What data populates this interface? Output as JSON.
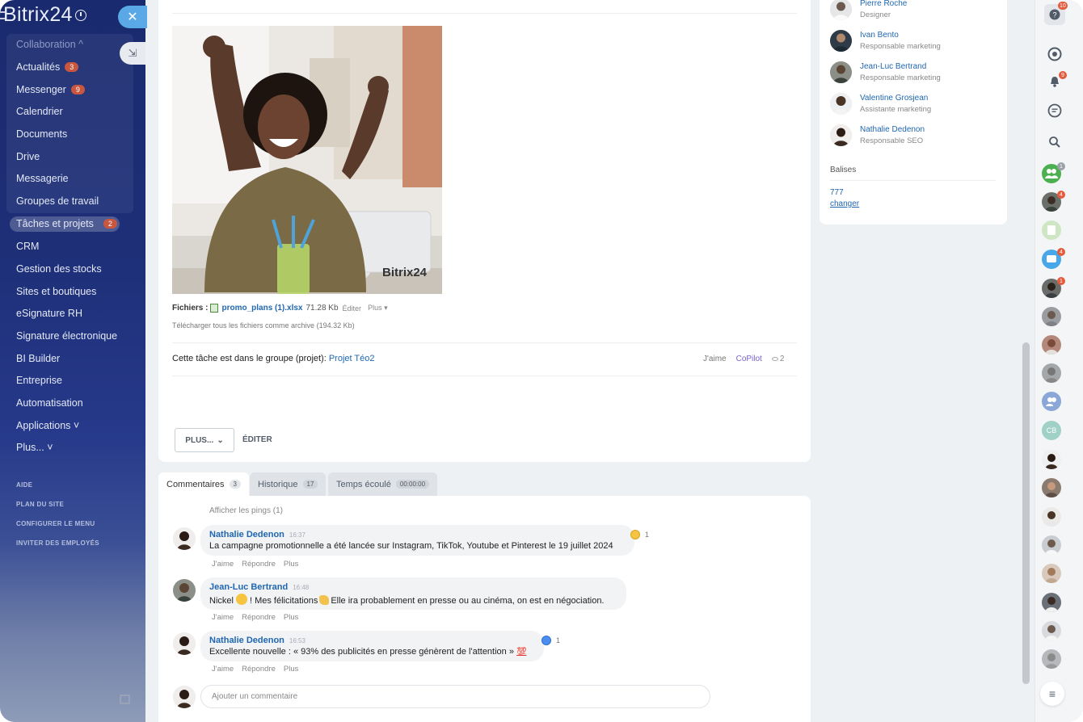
{
  "sidebar": {
    "logo": "Bitrix24",
    "collaboration_header": "Collaboration ^",
    "items": [
      {
        "label": "Actualités",
        "badge": "3"
      },
      {
        "label": "Messenger",
        "badge": "9"
      },
      {
        "label": "Calendrier"
      },
      {
        "label": "Documents"
      },
      {
        "label": "Drive"
      },
      {
        "label": "Messagerie"
      },
      {
        "label": "Groupes de travail"
      },
      {
        "label": "Tâches et projets",
        "badge": "2"
      },
      {
        "label": "CRM"
      },
      {
        "label": "Gestion des stocks"
      },
      {
        "label": "Sites et boutiques"
      },
      {
        "label": "eSignature RH"
      },
      {
        "label": "Signature électronique"
      },
      {
        "label": "BI Builder"
      },
      {
        "label": "Entreprise"
      },
      {
        "label": "Automatisation"
      },
      {
        "label": "Applications ˅"
      },
      {
        "label": "Plus... ˅"
      }
    ],
    "small_links": [
      "AIDE",
      "PLAN DU SITE",
      "CONFIGURER LE MENU",
      "INVITER DES EMPLOYÉS"
    ]
  },
  "task": {
    "watermark": "Bitrix24",
    "files_label": "Fichiers :",
    "file_name": "promo_plans (1).xlsx",
    "file_size": "71.28 Kb",
    "file_edit": "Éditer",
    "file_more": "Plus",
    "download_all": "Télécharger tous les fichiers comme archive (194.32 Kb)",
    "group_text": "Cette tâche est dans le groupe (projet):",
    "group_link": "Projet Téo2",
    "like": "J'aime",
    "copilot": "CoPilot",
    "views": "2",
    "plus_button": "PLUS...",
    "edit_button": "ÉDITER"
  },
  "tabs": [
    {
      "label": "Commentaires",
      "count": "3"
    },
    {
      "label": "Historique",
      "count": "17"
    },
    {
      "label": "Temps écoulé",
      "count": "00:00:00"
    }
  ],
  "comments": {
    "show_pings": "Afficher les pings (1)",
    "items": [
      {
        "author": "Nathalie Dedenon",
        "time": "16:37",
        "text": "La campagne promotionnelle a été lancée sur Instagram, TikTok, Youtube et Pinterest le 19 juillet 2024",
        "reaction_count": "1"
      },
      {
        "author": "Jean-Luc Bertrand",
        "time": "16:48",
        "text_a": "Nickel",
        "text_b": "! Mes félicitations",
        "text_c": "Elle ira probablement en presse ou au cinéma, on est en négociation."
      },
      {
        "author": "Nathalie Dedenon",
        "time": "16:53",
        "text": "Excellente nouvelle : « 93% des publicités en presse génèrent de l'attention »",
        "emoji_text": "💯",
        "reaction_count": "1"
      }
    ],
    "actions": {
      "like": "J'aime",
      "reply": "Répondre",
      "more": "Plus"
    },
    "add_placeholder": "Ajouter un commentaire"
  },
  "right_panel": {
    "people": [
      {
        "name": "Pierre Roche",
        "role": "Designer"
      },
      {
        "name": "Ivan Bento",
        "role": "Responsable marketing"
      },
      {
        "name": "Jean-Luc Bertrand",
        "role": "Responsable marketing"
      },
      {
        "name": "Valentine Grosjean",
        "role": "Assistante marketing"
      },
      {
        "name": "Nathalie Dedenon",
        "role": "Responsable SEO"
      }
    ],
    "tags_label": "Balises",
    "tag": "777",
    "change_link": "changer"
  },
  "rail": {
    "help_badge": "10",
    "notifications_badge": "9",
    "group_badge": "1",
    "chat_badges": [
      "4",
      "4",
      "1"
    ],
    "initials": "CB"
  }
}
